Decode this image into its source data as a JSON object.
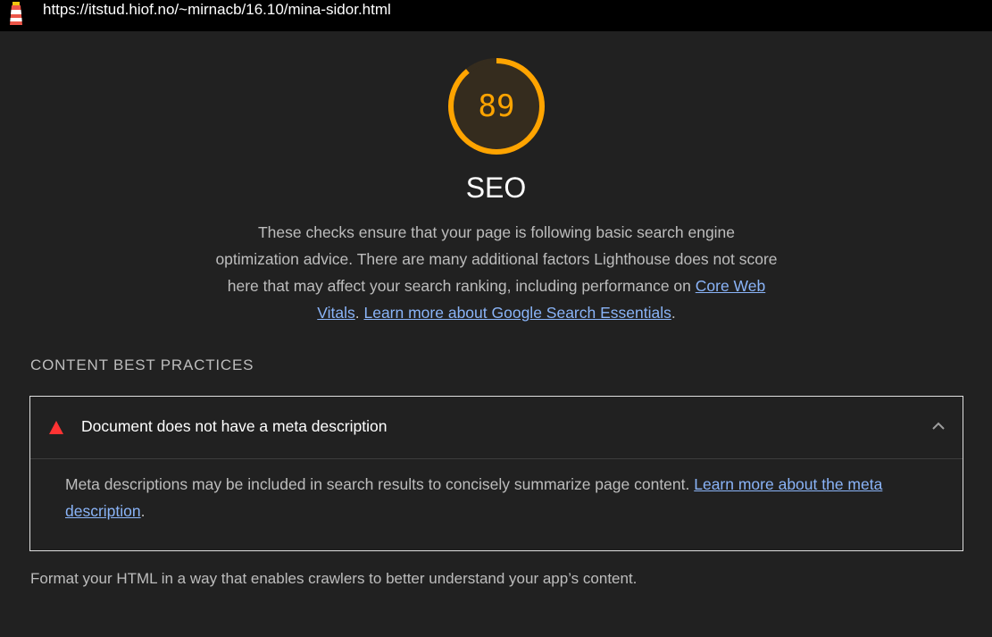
{
  "topbar": {
    "url": "https://itstud.hiof.no/~mirnacb/16.10/mina-sidor.html",
    "logo_icon": "lighthouse-icon"
  },
  "score": {
    "value": 89,
    "display": "89",
    "color": "#ffa400",
    "track_color": "#3a2f1c"
  },
  "category": {
    "title": "SEO",
    "description_text": "These checks ensure that your page is following basic search engine optimization advice. There are many additional factors Lighthouse does not score here that may affect your search ranking, including performance on ",
    "link1": "Core Web Vitals",
    "sep": ". ",
    "link2": "Learn more about Google Search Essentials",
    "end": "."
  },
  "group": {
    "title": "CONTENT BEST PRACTICES",
    "description": "Format your HTML in a way that enables crawlers to better understand your app’s content."
  },
  "audit": {
    "status_icon": "fail-triangle-icon",
    "status_color": "#ff3333",
    "title": "Document does not have a meta description",
    "toggle_icon": "chevron-up-icon",
    "body_text": "Meta descriptions may be included in search results to concisely summarize page content. ",
    "link": "Learn more about the meta description",
    "end": "."
  }
}
